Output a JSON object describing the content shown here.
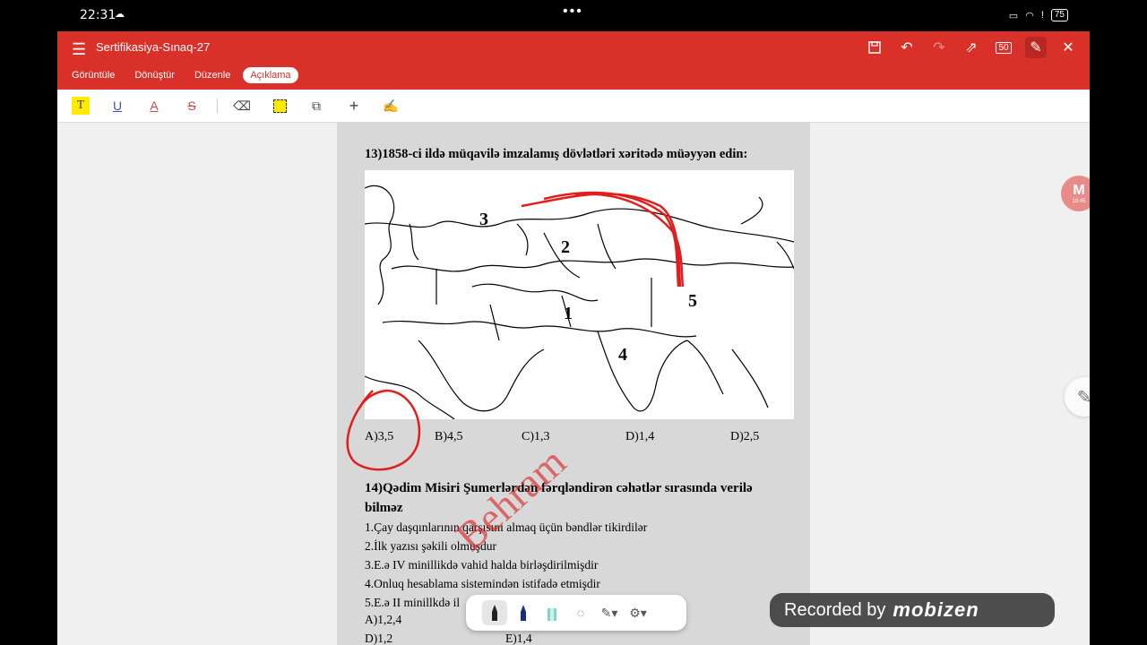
{
  "status_bar": {
    "time": "22:31",
    "battery": "75"
  },
  "toolbar": {
    "title": "Sertifikasiya-Sınaq-27",
    "page_count": "50",
    "tabs": [
      {
        "label": "Görüntüle"
      },
      {
        "label": "Dönüştür"
      },
      {
        "label": "Düzenle"
      },
      {
        "label": "Açıklama"
      }
    ]
  },
  "question13": {
    "text": "13)1858-ci ildə müqavilə imzalamış dövlətləri xəritədə müəyyən edin:",
    "map_labels": [
      "1",
      "2",
      "3",
      "4",
      "5"
    ],
    "answers": [
      "A)3,5",
      "B)4,5",
      "C)1,3",
      "D)1,4",
      "D)2,5"
    ]
  },
  "question14": {
    "text": "14)Qədim Misiri Şumerlərdən fərqləndirən cəhətlər sırasında verilə bilməz",
    "items": [
      "1.Çay daşqınlarının qarşısını almaq üçün bəndlər tikirdilər",
      "2.İlk yazısı şəkili olmuşdur",
      "3.E.ə IV minillikdə vahid halda birləşdirilmişdir",
      "4.Onluq hesablama sistemindən istifadə etmişdir",
      "5.E.ə II minillkdə il"
    ],
    "answers": [
      "A)1,2,4",
      "D)1,2",
      "E)1,4"
    ]
  },
  "watermark": "Behram",
  "side_bubble": {
    "letter": "M",
    "time": "10:45"
  },
  "recorder": {
    "label": "Recorded by",
    "brand": "mobizen"
  },
  "colors": {
    "toolbar": "#d9302a",
    "ink": "#e01e1e"
  }
}
